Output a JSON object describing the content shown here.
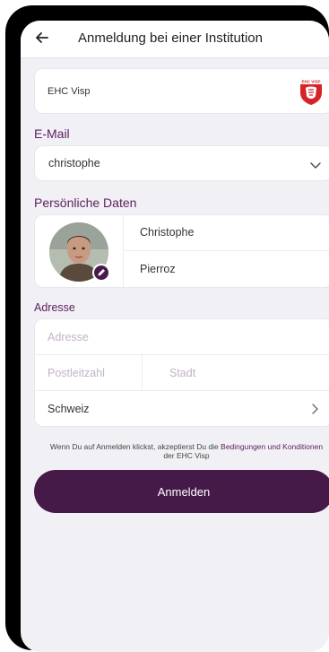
{
  "header": {
    "title": "Anmeldung bei einer Institution",
    "back_icon": "arrow-left-icon"
  },
  "institution": {
    "name": "EHC Visp",
    "logo_icon": "ehc-visp-logo",
    "logo_text": "EHC VISP"
  },
  "email": {
    "section_label": "E-Mail",
    "value": "christophe",
    "chevron_icon": "chevron-down-icon"
  },
  "personal": {
    "section_label": "Persönliche Daten",
    "first_name": "Christophe",
    "last_name": "Pierroz",
    "edit_icon": "pencil-icon"
  },
  "address": {
    "section_label": "Adresse",
    "address_placeholder": "Adresse",
    "postal_placeholder": "Postleitzahl",
    "city_placeholder": "Stadt",
    "country": "Schweiz",
    "chevron_icon": "chevron-right-icon"
  },
  "terms": {
    "prefix": "Wenn Du auf Anmelden klickst, akzeptierst Du die ",
    "link": "Bedingungen und Konditionen",
    "suffix": " der EHC Visp"
  },
  "submit_label": "Anmelden",
  "colors": {
    "accent": "#5e2160",
    "button": "#461a48",
    "background": "#f1f0f5"
  }
}
